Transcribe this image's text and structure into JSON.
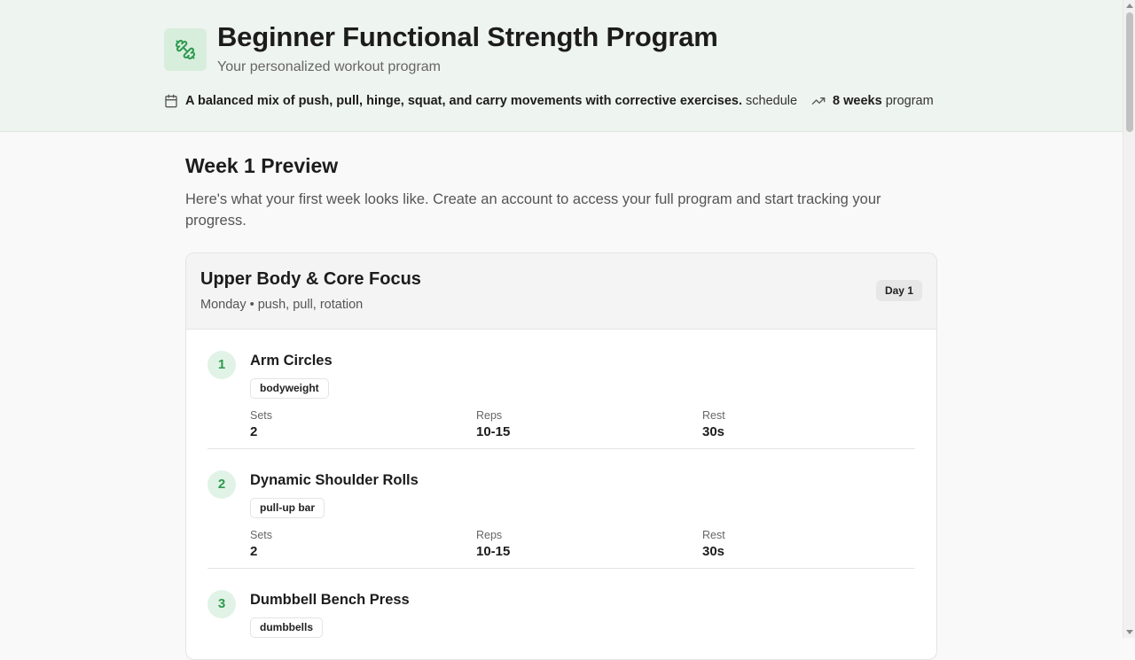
{
  "header": {
    "title": "Beginner Functional Strength Program",
    "subtitle": "Your personalized workout program",
    "description": "A balanced mix of push, pull, hinge, squat, and carry movements with corrective exercises.",
    "schedule_label": "schedule",
    "weeks": "8 weeks",
    "program_label": "program",
    "logo_icon": "dumbbell-icon",
    "accent_color": "#2e9a4f"
  },
  "preview": {
    "title": "Week 1 Preview",
    "description": "Here's what your first week looks like. Create an account to access your full program and start tracking your progress."
  },
  "day": {
    "title": "Upper Body & Core Focus",
    "subtitle": "Monday • push, pull, rotation",
    "badge": "Day 1",
    "labels": {
      "sets": "Sets",
      "reps": "Reps",
      "rest": "Rest"
    },
    "exercises": [
      {
        "number": "1",
        "name": "Arm Circles",
        "equipment": "bodyweight",
        "sets": "2",
        "reps": "10-15",
        "rest": "30s"
      },
      {
        "number": "2",
        "name": "Dynamic Shoulder Rolls",
        "equipment": "pull-up bar",
        "sets": "2",
        "reps": "10-15",
        "rest": "30s"
      },
      {
        "number": "3",
        "name": "Dumbbell Bench Press",
        "equipment": "dumbbells",
        "sets": "",
        "reps": "",
        "rest": ""
      }
    ]
  }
}
